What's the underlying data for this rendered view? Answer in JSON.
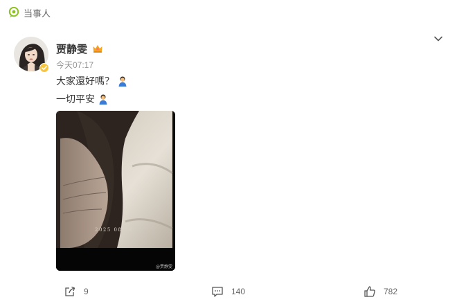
{
  "source": {
    "name": "当事人",
    "logo_icon": "source-logo-icon",
    "accent": "#8dc21f"
  },
  "author": {
    "name": "贾静雯",
    "verified_icon": "verified-badge-icon",
    "vip_icon": "vip-crown-icon",
    "time": "今天07:17"
  },
  "post": {
    "lines": [
      {
        "text": "大家還好嗎？",
        "emoji": "praying-person-emoji"
      },
      {
        "text": "一切平安",
        "emoji": "praying-person-emoji"
      }
    ],
    "image": {
      "date_stamp": "2025 08 20",
      "watermark": "@贾静雯"
    }
  },
  "actions": {
    "share_count": "9",
    "comment_count": "140",
    "like_count": "782"
  },
  "colors": {
    "text": "#333333",
    "muted": "#939393",
    "vip_gold": "#f5a623",
    "verified_gold": "#f7c53f"
  }
}
